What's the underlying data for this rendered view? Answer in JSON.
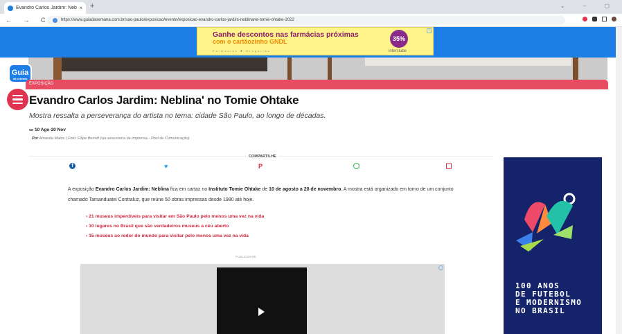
{
  "browser": {
    "tab_title": "Evandro Carlos Jardim: Neblina",
    "tab_close": "×",
    "new_tab": "+",
    "nav_glyphs": "← → C ⌂",
    "url": "https://www.guiadasemana.com.br/sao-paulo/exposicao/evento/exposicao-evandro-carlos-jardim-neblinane-tomie-ohtake-2022",
    "window_controls": "⌄ – ▢"
  },
  "top_ad": {
    "line1": "Ganhe descontos nas farmácias próximas",
    "line2": "com o cartãozinho GNDL",
    "badge": "35%",
    "brand": "interclube",
    "logos": "Farmácias ✚ Drogarias"
  },
  "site": {
    "logo": "Guia",
    "logo_sub": "da semana"
  },
  "article": {
    "category": "EXPOSIÇÃO",
    "title": "Evandro Carlos Jardim: Neblina' no Tomie Ohtake",
    "subtitle": "Mostra ressalta a perseverança do artista no tema: cidade São Paulo, ao longo de décadas.",
    "date": "10 Ago-20 Nov",
    "byline_prefix": "Por",
    "author": "Amanda Matos",
    "photo_credit": "| Foto: Filipe Berndt (via assessoria de imprensa - Pool de Comunicação)",
    "share_label": "COMPARTILHE",
    "body_parts": {
      "p1": "A exposição ",
      "b1": "Evandro Carlos Jardim: Neblina",
      "p2": " fica em cartaz no ",
      "b2": "Instituto Tomie Ohtake",
      "p3": " de ",
      "b3": "10 de agosto a 20 de novembro",
      "p4": ". A mostra está organizado em torno de um conjunto chamado Tamanduatei Contraluz, que reúne 50 obras impressas desde 1980 até hoje."
    },
    "related_links": [
      "21 museus imperdíveis para visitar em São Paulo pelo menos uma vez na vida",
      "10 lugares no Brasil que são verdadeiros museus a céu aberto",
      "15 museus ao redor do mundo para visitar pelo menos uma vez na vida"
    ],
    "ad_label": "PUBLICIDADE"
  },
  "side_ad": {
    "text": "100 ANOS\nDE FUTEBOL\nE MODERNISMO\nNO BRASIL"
  }
}
